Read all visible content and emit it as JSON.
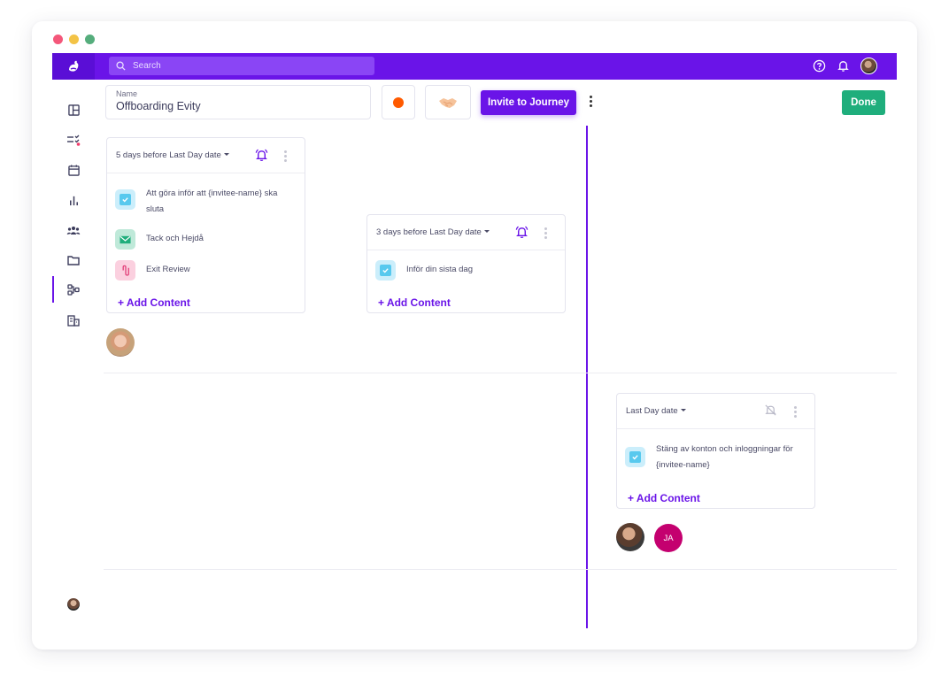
{
  "window_controls": {
    "close_color": "#f4577a",
    "minimize_color": "#f3c346",
    "zoom_color": "#55ad7c"
  },
  "topbar": {
    "color": "#6a14e8",
    "logo_icon": "bird-logo-icon",
    "search_placeholder": "Search",
    "icons": [
      "help-icon",
      "bell-icon",
      "user-avatar"
    ]
  },
  "sidebar": {
    "items": [
      {
        "icon": "layout-icon"
      },
      {
        "icon": "tasks-icon"
      },
      {
        "icon": "calendar-icon"
      },
      {
        "icon": "chart-icon"
      },
      {
        "icon": "people-icon"
      },
      {
        "icon": "folder-icon"
      },
      {
        "icon": "journey-icon",
        "active": true
      },
      {
        "icon": "building-icon"
      }
    ]
  },
  "toolbar": {
    "name_label": "Name",
    "name_value": "Offboarding Evity",
    "color_value": "#ff5a00",
    "emoji_icon": "handshake-icon",
    "invite_label": "Invite to Journey",
    "done_label": "Done",
    "accent": "#6a14e8",
    "done_color": "#1fae7c"
  },
  "cards": [
    {
      "title": "5 days before Last Day date",
      "bell": "active",
      "items": [
        {
          "type": "task",
          "text_line1": "Att göra inför att {invitee-name} ska",
          "text_line2": "sluta"
        },
        {
          "type": "email",
          "text_line1": "Tack och Hejdå",
          "text_line2": ""
        },
        {
          "type": "attachment",
          "text_line1": "Exit Review",
          "text_line2": ""
        }
      ],
      "add_label": "+ Add Content"
    },
    {
      "title": "3 days before Last Day date",
      "bell": "active",
      "items": [
        {
          "type": "task",
          "text_line1": "Inför din sista dag",
          "text_line2": ""
        }
      ],
      "add_label": "+ Add Content"
    },
    {
      "title": "Last Day date",
      "bell": "muted",
      "items": [
        {
          "type": "task",
          "text_line1": "Stäng av konton och inloggningar för",
          "text_line2": "{invitee-name}"
        }
      ],
      "add_label": "+ Add Content"
    }
  ],
  "avatars": {
    "row1": [
      "woman-avatar"
    ],
    "row2": [
      "man-avatar",
      "JA"
    ]
  }
}
